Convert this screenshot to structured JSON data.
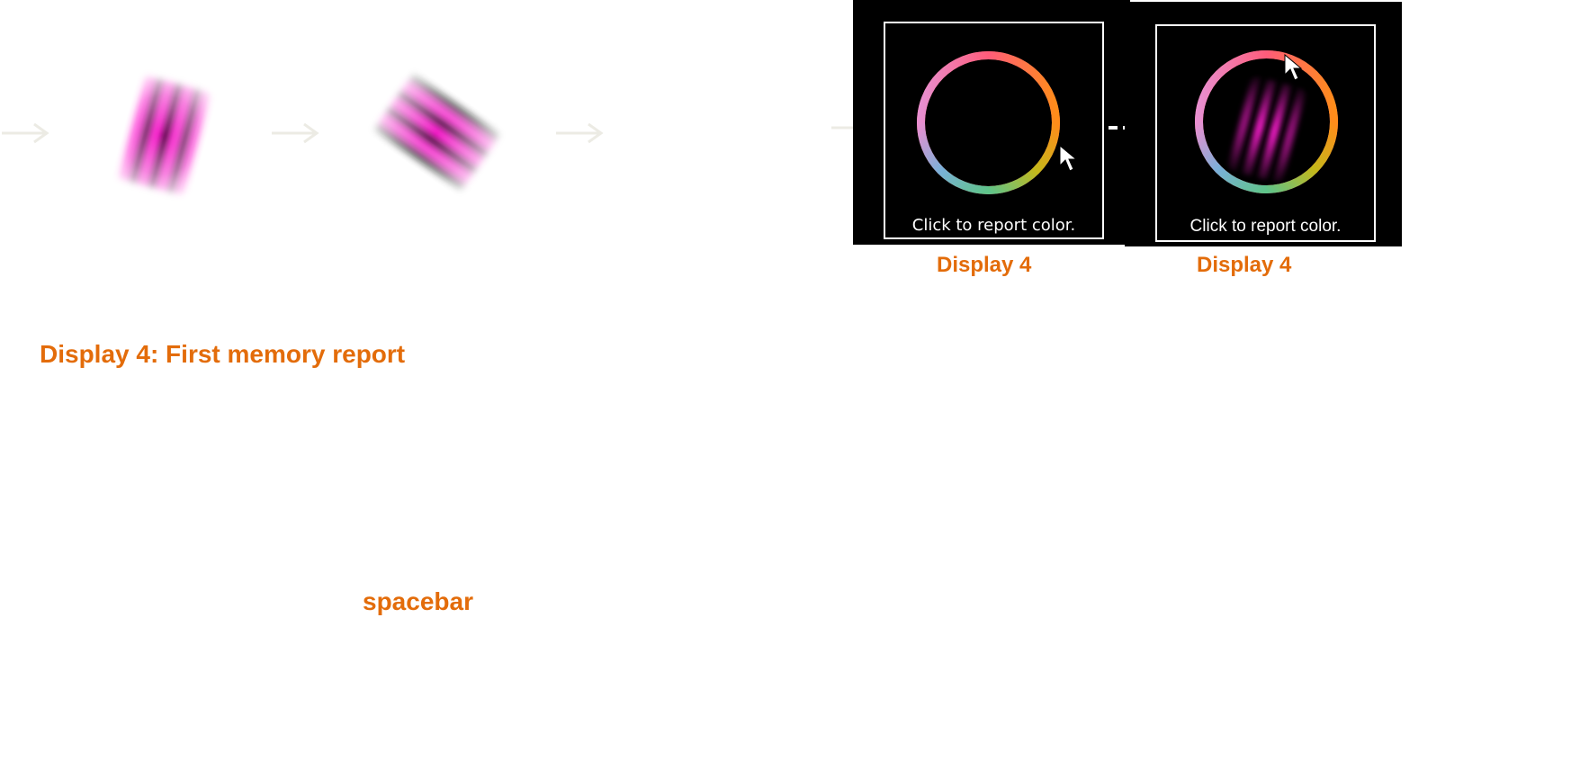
{
  "stimulus_sequence": {
    "gabor_color": "#ff1fd2",
    "faint_arrow_color": "#ecebe4"
  },
  "displays": [
    {
      "label": "Display 4",
      "prompt": "Click to report color."
    },
    {
      "label": "Display 4",
      "prompt": "Click to report color."
    }
  ],
  "section_title": "Display 4: First memory report",
  "key_label": "spacebar",
  "colors": {
    "accent_orange": "#e36c0a",
    "panel_background": "#000000",
    "screen_border": "#ffffff",
    "dashed_arrow": "#ffffff",
    "solid_arrow": "#ecebe4"
  },
  "icons": {
    "cursor": "mouse-pointer-icon",
    "color_wheel": "color-wheel-icon"
  }
}
